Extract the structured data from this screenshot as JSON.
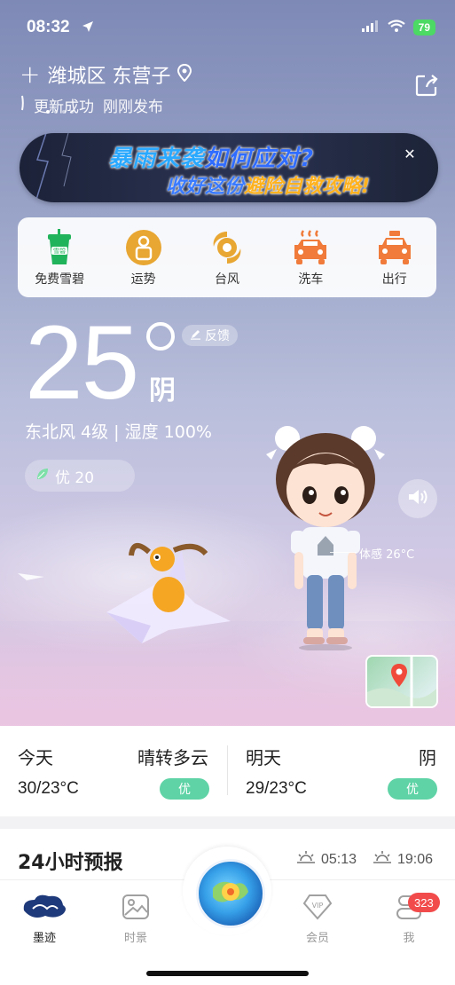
{
  "status_bar": {
    "time": "08:32",
    "battery": "79"
  },
  "location": {
    "name": "潍城区 东营子",
    "update_status": "更新成功",
    "publish_time": "刚刚发布"
  },
  "banner": {
    "line1_part1": "暴雨来袭",
    "line1_part2": "如何应对?",
    "line2_part1": "收好这份",
    "line2_part2": "避险自救攻略!",
    "close_glyph": "✕"
  },
  "services": [
    {
      "label": "免费雪碧",
      "icon": "cup-icon",
      "icon_text": "雪碧",
      "color": "#21b35b"
    },
    {
      "label": "运势",
      "icon": "fortune-icon",
      "color": "#e8a632"
    },
    {
      "label": "台风",
      "icon": "typhoon-icon",
      "color": "#e8a632"
    },
    {
      "label": "洗车",
      "icon": "car-wash-icon",
      "color": "#f07b3a"
    },
    {
      "label": "出行",
      "icon": "taxi-icon",
      "color": "#f07b3a"
    }
  ],
  "current": {
    "temperature": "25",
    "condition": "阴",
    "feedback_label": "反馈",
    "wind_humidity": "东北风 4级 | 湿度 100%",
    "aqi_label": "优 20",
    "feels_like": "体感 26°C"
  },
  "forecast": {
    "today": {
      "day": "今天",
      "condition": "晴转多云",
      "temp": "30/23°C",
      "aqi": "优"
    },
    "tomorrow": {
      "day": "明天",
      "condition": "阴",
      "temp": "29/23°C",
      "aqi": "优"
    }
  },
  "hourly": {
    "title": "24小时预报",
    "sunrise": "05:13",
    "sunset": "19:06"
  },
  "tabbar": {
    "tabs": [
      {
        "label": "墨迹",
        "icon": "moji-cloud-icon",
        "active": true
      },
      {
        "label": "时景",
        "icon": "image-icon",
        "active": false
      },
      {
        "label": "会员",
        "icon": "vip-icon",
        "active": false
      },
      {
        "label": "我",
        "icon": "profile-icon",
        "active": false
      }
    ],
    "me_badge": "323"
  },
  "colors": {
    "aqi_green": "#5fd3a6",
    "badge_red": "#f24b4b",
    "battery_green": "#4cd964"
  }
}
